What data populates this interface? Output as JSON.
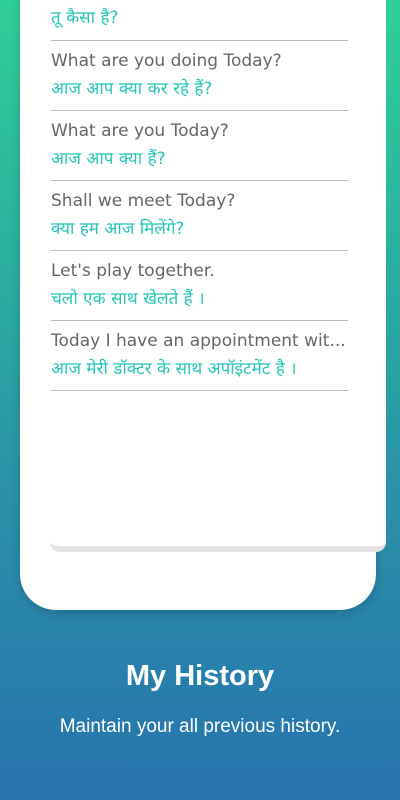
{
  "history": {
    "items": [
      {
        "english": "",
        "hindi": "तू कैसा है?"
      },
      {
        "english": "What are you doing Today?",
        "hindi": "आज आप क्या कर रहे हैं?"
      },
      {
        "english": "What are you Today?",
        "hindi": "आज आप क्या हैं?"
      },
      {
        "english": "Shall we meet Today?",
        "hindi": "क्या हम आज मिलेंगे?"
      },
      {
        "english": "Let's play together.",
        "hindi": "चलो एक साथ खेलते हैं ।"
      },
      {
        "english": "Today I have an appointment wit...",
        "hindi": "आज मेरी डॉक्टर के साथ अपॉइंटमेंट है ।"
      }
    ]
  },
  "promo": {
    "title": "My History",
    "subtitle": "Maintain your all previous history."
  },
  "colors": {
    "english_text": "#666666",
    "hindi_text": "#25c6b6",
    "gradient_top": "#2fcf98",
    "gradient_bottom": "#2872ae"
  }
}
